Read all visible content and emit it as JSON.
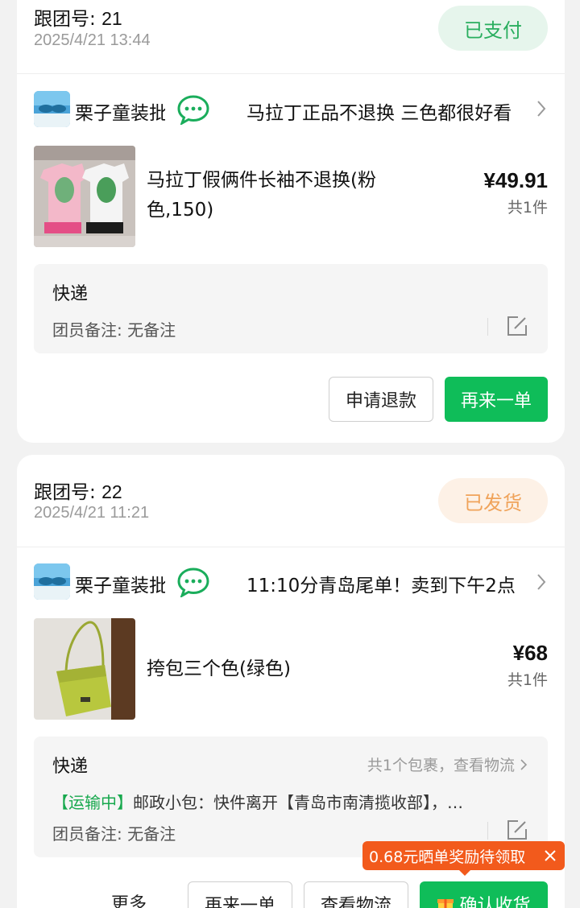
{
  "orders": [
    {
      "group_label": "跟团号:",
      "group_number": "21",
      "datetime": "2025/4/21 13:44",
      "status": "已支付",
      "shop_name": "栗子童装批",
      "shop_note": "马拉丁正品不退换 三色都很好看",
      "product_title": "马拉丁假俩件长袖不退换(粉色,150)",
      "price": "¥49.91",
      "qty": "共1件",
      "shipping_method": "快递",
      "remark": "团员备注: 无备注",
      "buttons": [
        "申请退款",
        "再来一单"
      ]
    },
    {
      "group_label": "跟团号:",
      "group_number": "22",
      "datetime": "2025/4/21 11:21",
      "status": "已发货",
      "shop_name": "栗子童装批",
      "shop_note": "11:10分青岛尾单！卖到下午2点",
      "product_title": "挎包三个色(绿色)",
      "price": "¥68",
      "qty": "共1件",
      "shipping_method": "快递",
      "package_link": "共1个包裹，查看物流",
      "tracking_status": "【运输中】",
      "tracking_detail": "邮政小包：快件离开【青岛市南清揽收部】，…",
      "remark": "团员备注: 无备注",
      "more": "更多",
      "buttons": [
        "再来一单",
        "查看物流",
        "确认收货"
      ]
    }
  ],
  "promo_banner": "0.68元晒单奖励待领取",
  "colors": {
    "green": "#0fbd59",
    "paid_badge_bg": "#e6f5ec",
    "shipped_badge_text": "#f0a35a",
    "promo": "#f25a1c"
  }
}
